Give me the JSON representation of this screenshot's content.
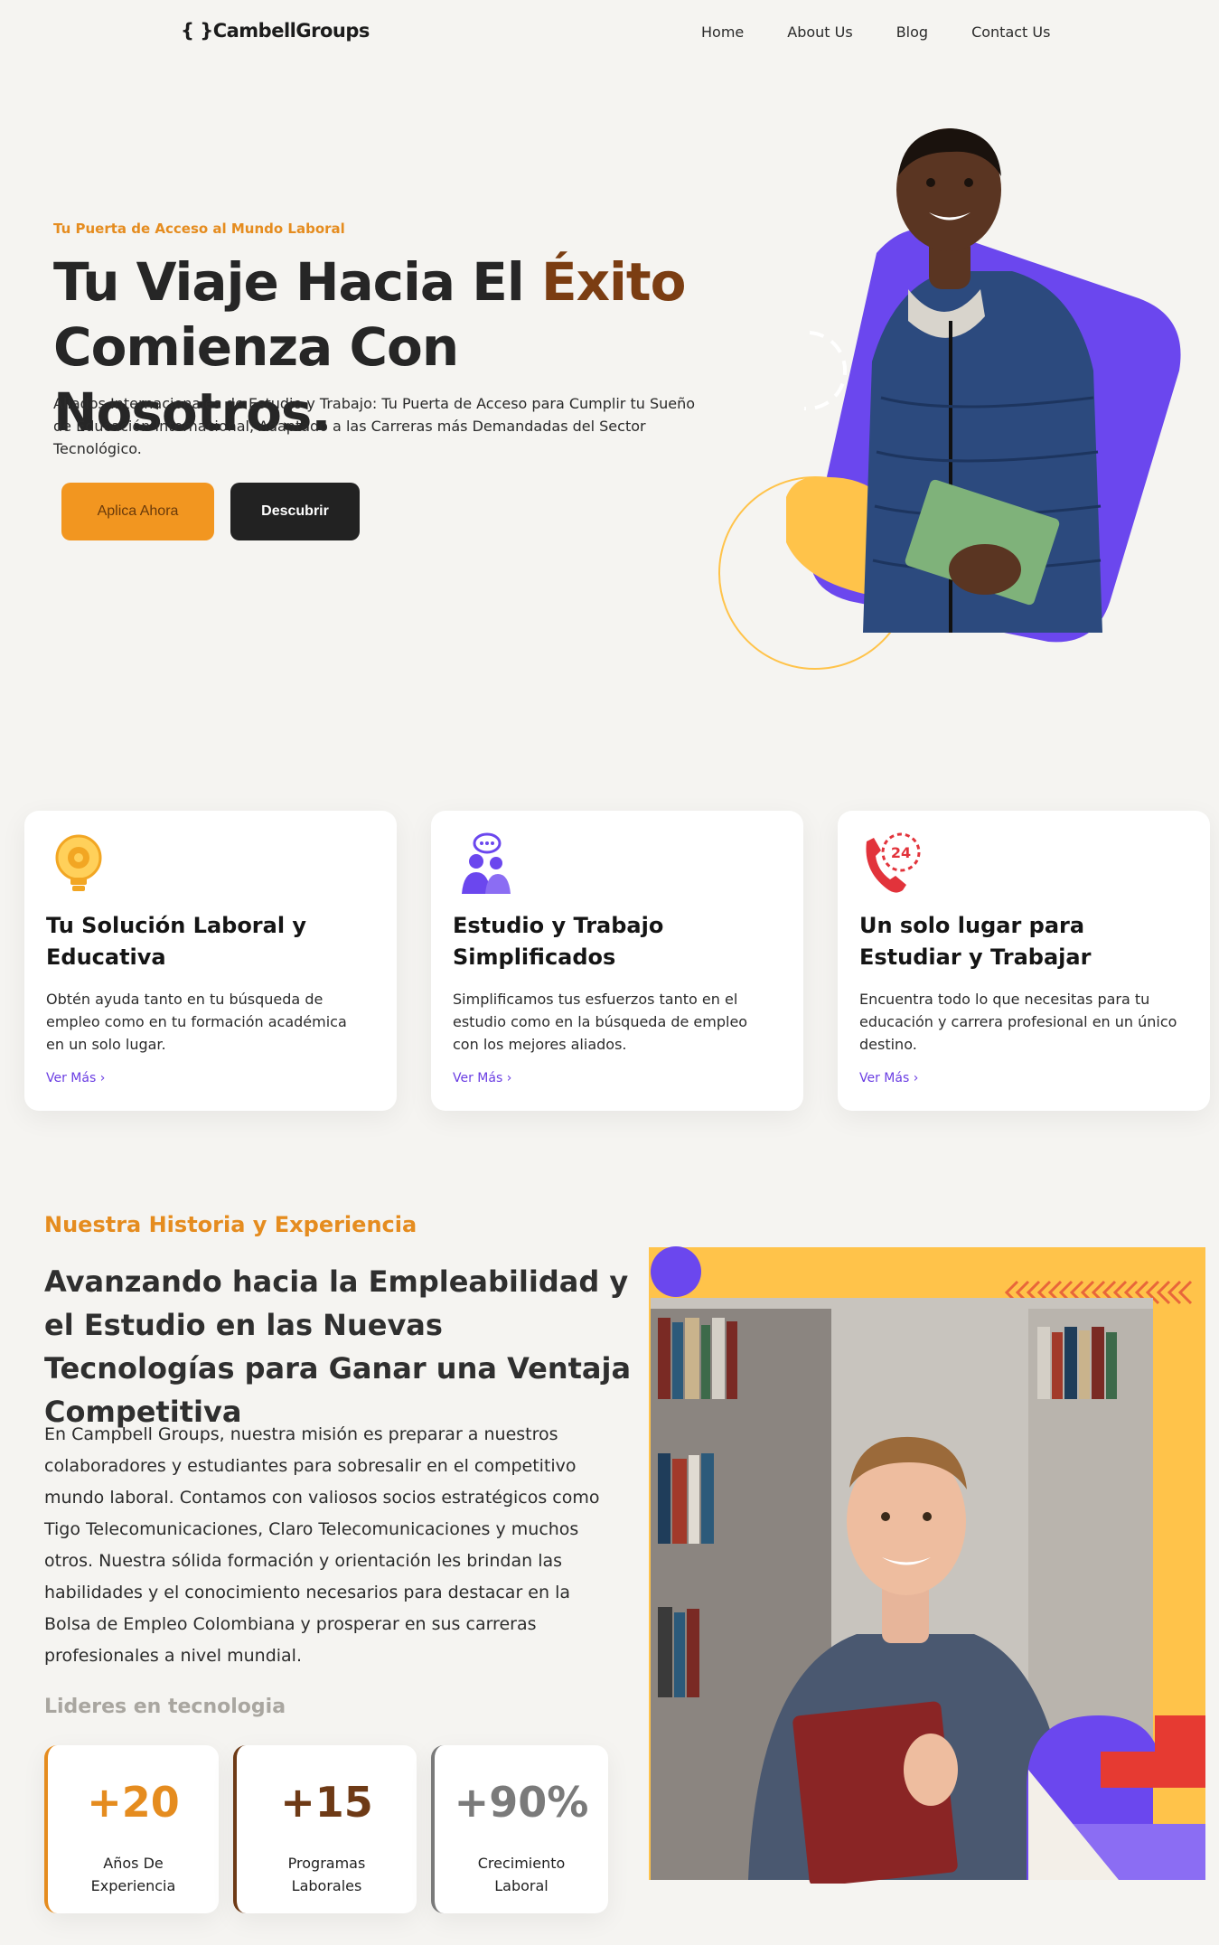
{
  "nav": {
    "logo": "{ }CambellGroups",
    "links": [
      "Home",
      "About Us",
      "Blog",
      "Contact Us"
    ]
  },
  "hero": {
    "eyebrow": "Tu Puerta de Acceso al Mundo Laboral",
    "title_part1": "Tu Viaje Hacia El ",
    "title_accent": "Éxito",
    "title_part2": "Comienza Con Nosotros.",
    "description": "Aliados Internacionales de Estudio y Trabajo: Tu Puerta de Acceso para Cumplir tu Sueño de Educación Internacional, Adaptado a las Carreras más Demandadas del Sector Tecnológico.",
    "apply_button": "Aplica Ahora",
    "discover_button": "Descubrir",
    "colors": {
      "orange": "#f29620",
      "purple": "#6b47ee",
      "yellow": "#ffc34a",
      "dark": "#222222"
    }
  },
  "cards": [
    {
      "icon": "lightbulb-gear-icon",
      "title": "Tu Solución Laboral y Educativa",
      "text": "Obtén ayuda tanto en tu búsqueda de empleo como en tu formación académica en un solo lugar.",
      "link": "Ver Más ›"
    },
    {
      "icon": "people-chat-icon",
      "title": "Estudio y Trabajo Simplificados",
      "text": "Simplificamos tus esfuerzos tanto en el estudio como en la búsqueda de empleo con los mejores aliados.",
      "link": "Ver Más ›"
    },
    {
      "icon": "phone-24h-icon",
      "title": "Un solo lugar para Estudiar y Trabajar",
      "text": "Encuentra todo lo que necesitas para tu educación y carrera profesional en un único destino.",
      "link": "Ver Más ›"
    }
  ],
  "history": {
    "eyebrow": "Nuestra Historia y Experiencia",
    "title": "Avanzando hacia la Empleabilidad y el Estudio en las Nuevas Tecnologías para Ganar una Ventaja Competitiva",
    "body": "En Campbell Groups, nuestra misión es preparar a nuestros colaboradores y estudiantes para sobresalir en el competitivo mundo laboral. Contamos con valiosos socios estratégicos como Tigo Telecomunicaciones, Claro Telecomunicaciones y muchos otros. Nuestra sólida formación y orientación les brindan las habilidades y el conocimiento necesarios para destacar en la Bolsa de Empleo Colombiana y prosperar en sus carreras profesionales a nivel mundial.",
    "leaders_label": "Lideres en tecnologia",
    "stats": [
      {
        "value": "+20",
        "label": "Años De Experiencia",
        "color": "#e58c1f"
      },
      {
        "value": "+15",
        "label": "Programas Laborales",
        "color": "#6e3a16"
      },
      {
        "value": "+90%",
        "label": "Crecimiento Laboral",
        "color": "#7a7a7a"
      }
    ]
  }
}
